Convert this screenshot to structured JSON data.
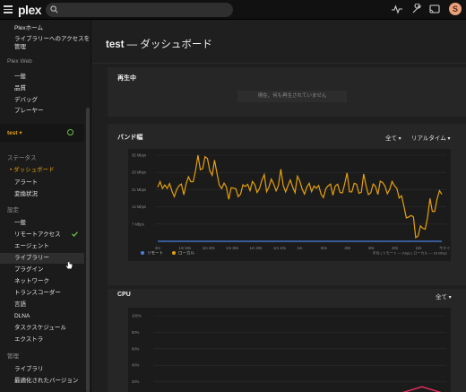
{
  "topbar": {
    "logo": "plex",
    "search_placeholder": "",
    "avatar_letter": "S"
  },
  "sidebar": {
    "top_items": [
      "Plexホーム",
      "ライブラリーへのアクセスを",
      "管理"
    ],
    "plex_web_header": "Plex Web",
    "plex_web_items": [
      "一般",
      "品質",
      "デバッグ",
      "プレーヤー"
    ],
    "server_name": "test",
    "status_header": "ステータス",
    "status_items": [
      "ダッシュボード",
      "アラート",
      "変換状況"
    ],
    "settings_header": "設定",
    "settings_items": [
      "一般",
      "リモートアクセス",
      "エージェント",
      "ライブラリー",
      "プラグイン",
      "ネットワーク",
      "トランスコーダー",
      "言語",
      "DLNA",
      "タスクスケジュール",
      "エクストラ"
    ],
    "manage_header": "管理",
    "manage_items": [
      "ライブラリ",
      "最適化されたバージョン"
    ]
  },
  "main": {
    "server": "test",
    "title_suffix": "— ダッシュボード",
    "now_playing": {
      "title": "再生中",
      "empty_message": "現在、何も再生されていません"
    },
    "bandwidth": {
      "title": "バンド幅",
      "filter": "全て",
      "range": "リアルタイム",
      "footer_stats": "平均 | リモート — Kbps | ローカル — 16 Mbps"
    },
    "cpu": {
      "title": "CPU",
      "filter": "全て"
    }
  },
  "chart_data": [
    {
      "type": "line",
      "title": "バンド幅",
      "ylabel_ticks": [
        "35 Mbps",
        "28 Mbps",
        "21 Mbps",
        "14 Mbps",
        "7 Mbps"
      ],
      "x": [
        "2m",
        "1m 50s",
        "1m 40s",
        "1m 30s",
        "1m 20s",
        "1m 10s",
        "1m",
        "50s",
        "40s",
        "30s",
        "20s",
        "10s",
        "今すぐ"
      ],
      "ylim": [
        0,
        35
      ],
      "series": [
        {
          "name": "リモート",
          "color": "#4a7fe0",
          "values": [
            0,
            0,
            0,
            0,
            0,
            0,
            0,
            0,
            0,
            0,
            0,
            0,
            0
          ]
        },
        {
          "name": "ローカル",
          "color": "#e5a00d",
          "values": [
            22,
            20,
            33,
            19,
            22,
            23,
            22,
            20,
            22,
            21,
            22,
            2,
            20
          ]
        }
      ],
      "legend": "bottom-left",
      "grid": true
    },
    {
      "type": "line",
      "title": "CPU",
      "ylabel_ticks": [
        "100%",
        "80%",
        "60%",
        "40%",
        "20%"
      ],
      "ylim": [
        0,
        100
      ],
      "series": [
        {
          "name": "",
          "color": "#e0305f",
          "values": [
            0,
            0,
            0,
            0,
            0,
            0,
            0,
            0,
            0,
            0,
            5,
            14,
            5
          ]
        }
      ],
      "grid": true
    }
  ],
  "colors": {
    "accent": "#e5a00d",
    "remote": "#4a7fe0",
    "cpu": "#e0305f",
    "ok": "#6cc04a"
  }
}
